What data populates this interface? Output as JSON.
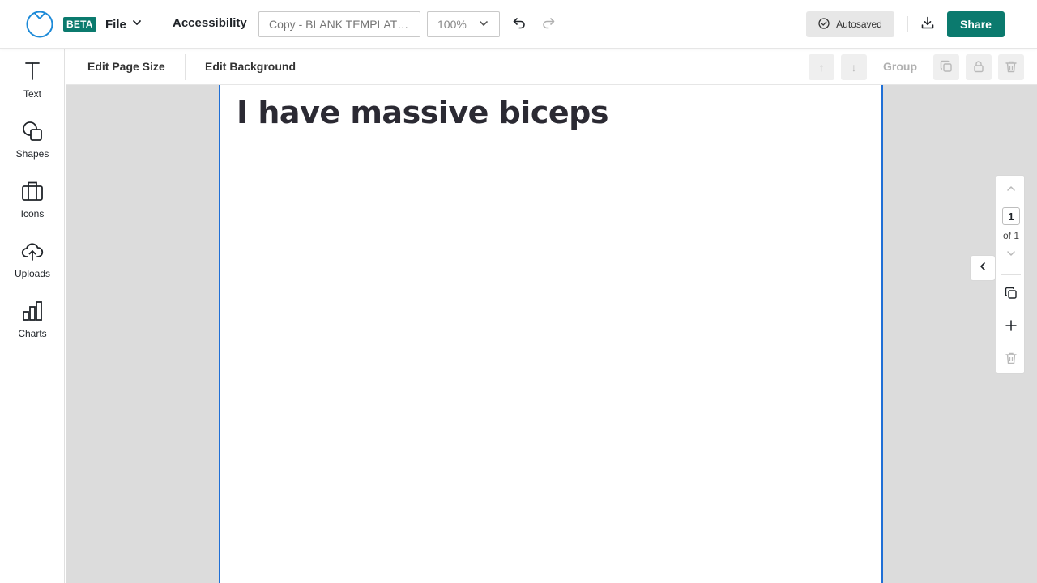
{
  "header": {
    "beta_badge": "BETA",
    "file_menu_label": "File",
    "accessibility_label": "Accessibility",
    "document_name_placeholder": "Copy - BLANK TEMPLAT…",
    "zoom_value": "100%",
    "autosaved_label": "Autosaved",
    "share_label": "Share"
  },
  "sidebar": {
    "items": [
      {
        "label": "Text",
        "icon": "text-icon"
      },
      {
        "label": "Shapes",
        "icon": "shapes-icon"
      },
      {
        "label": "Icons",
        "icon": "icons-icon"
      },
      {
        "label": "Uploads",
        "icon": "upload-icon"
      },
      {
        "label": "Charts",
        "icon": "chart-icon"
      }
    ]
  },
  "subtoolbar": {
    "edit_page_size_label": "Edit Page Size",
    "edit_background_label": "Edit Background",
    "move_up_label": "↑",
    "move_down_label": "↓",
    "group_label": "Group"
  },
  "canvas": {
    "heading_text": "I have massive biceps"
  },
  "page_nav": {
    "current_page": "1",
    "total_label": "of 1"
  },
  "colors": {
    "brand_teal": "#0b7a6e",
    "selection_blue": "#1f6fd6",
    "canvas_bg": "#dcdcdc",
    "logo_blue": "#1d8ad8"
  }
}
